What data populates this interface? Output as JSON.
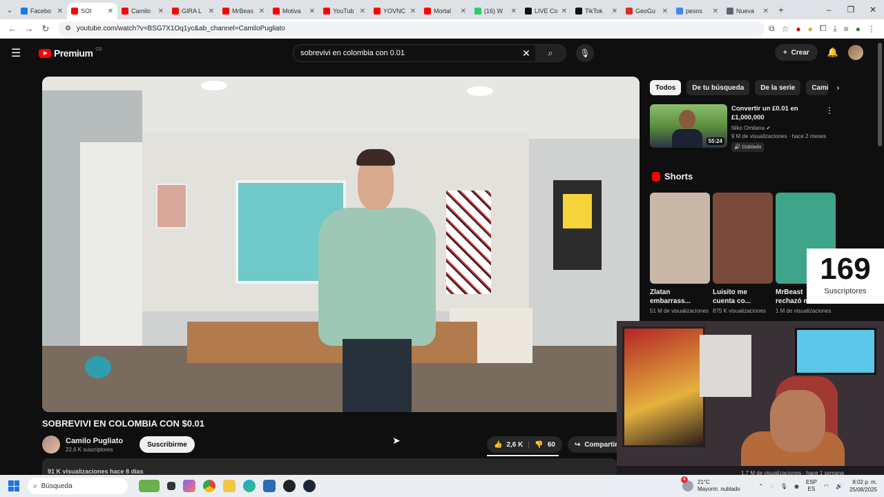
{
  "browser": {
    "tabs": [
      {
        "label": "Facebo",
        "color": "#1877f2"
      },
      {
        "label": "SOI",
        "color": "#ff0000",
        "active": true
      },
      {
        "label": "Camilo",
        "color": "#ff0000"
      },
      {
        "label": "GIRA L",
        "color": "#ff0000"
      },
      {
        "label": "MrBeas",
        "color": "#ff0000"
      },
      {
        "label": "Motiva",
        "color": "#ff0000"
      },
      {
        "label": "YouTub",
        "color": "#ff0000"
      },
      {
        "label": "YOVNC",
        "color": "#ff0000"
      },
      {
        "label": "Mortal",
        "color": "#ff0000"
      },
      {
        "label": "(16) W",
        "color": "#25d366"
      },
      {
        "label": "LIVE Co",
        "color": "#111111"
      },
      {
        "label": "TikTok",
        "color": "#111111"
      },
      {
        "label": "GeoGu",
        "color": "#d93025"
      },
      {
        "label": "pesos",
        "color": "#4285f4"
      },
      {
        "label": "Nueva",
        "color": "#5f6368"
      }
    ],
    "url": "youtube.com/watch?v=BSG7X1Oq1yc&ab_channel=CamiloPugliato"
  },
  "youtube": {
    "logo_text": "Premium",
    "logo_country": "CO",
    "search_query": "sobrevivi en colombia con 0.01",
    "create_label": "Crear"
  },
  "video": {
    "title": "SOBREVIVI EN COLOMBIA CON $0.01",
    "channel_name": "Camilo Pugliato",
    "channel_subs": "22,6 K suscriptores",
    "subscribe_label": "Suscribirme",
    "likes": "2,6 K",
    "dislikes": "60",
    "share_label": "Compartir",
    "views_line": "91 K visualizaciones  hace 8 días"
  },
  "sidebar": {
    "chips": [
      "Todos",
      "De tu búsqueda",
      "De la serie",
      "Camil"
    ],
    "reco": {
      "title": "Convertir un £0.01 en £1,000,000",
      "channel": "Niko Omilana",
      "meta": "9 M de visualizaciones · hace 2 meses",
      "badge": "Doblado",
      "duration": "55:24"
    },
    "shorts_label": "Shorts",
    "shorts": [
      {
        "title": "Zlatan embarrass...",
        "views": "51 M de visualizaciones",
        "color": "#c9b8a8"
      },
      {
        "title": "Luisito me cuenta co...",
        "views": "875 K visualizaciones",
        "color": "#7a4a3a"
      },
      {
        "title": "MrBeast rechazó mi...",
        "views": "1 M de visualizaciones",
        "color": "#3fa58a"
      }
    ]
  },
  "overlay": {
    "sub_count": "169",
    "sub_label": "Suscriptores",
    "webcam_ghost_text": "1,7 M de visualizaciones · hace 1 semana"
  },
  "taskbar": {
    "search_label": "Búsqueda",
    "weather_temp": "21°C",
    "weather_desc": "Mayorm. nublado",
    "weather_badge": "4",
    "lang_top": "ESP",
    "lang_bottom": "ES",
    "time": "8:02 p. m.",
    "date": "25/08/2025"
  }
}
